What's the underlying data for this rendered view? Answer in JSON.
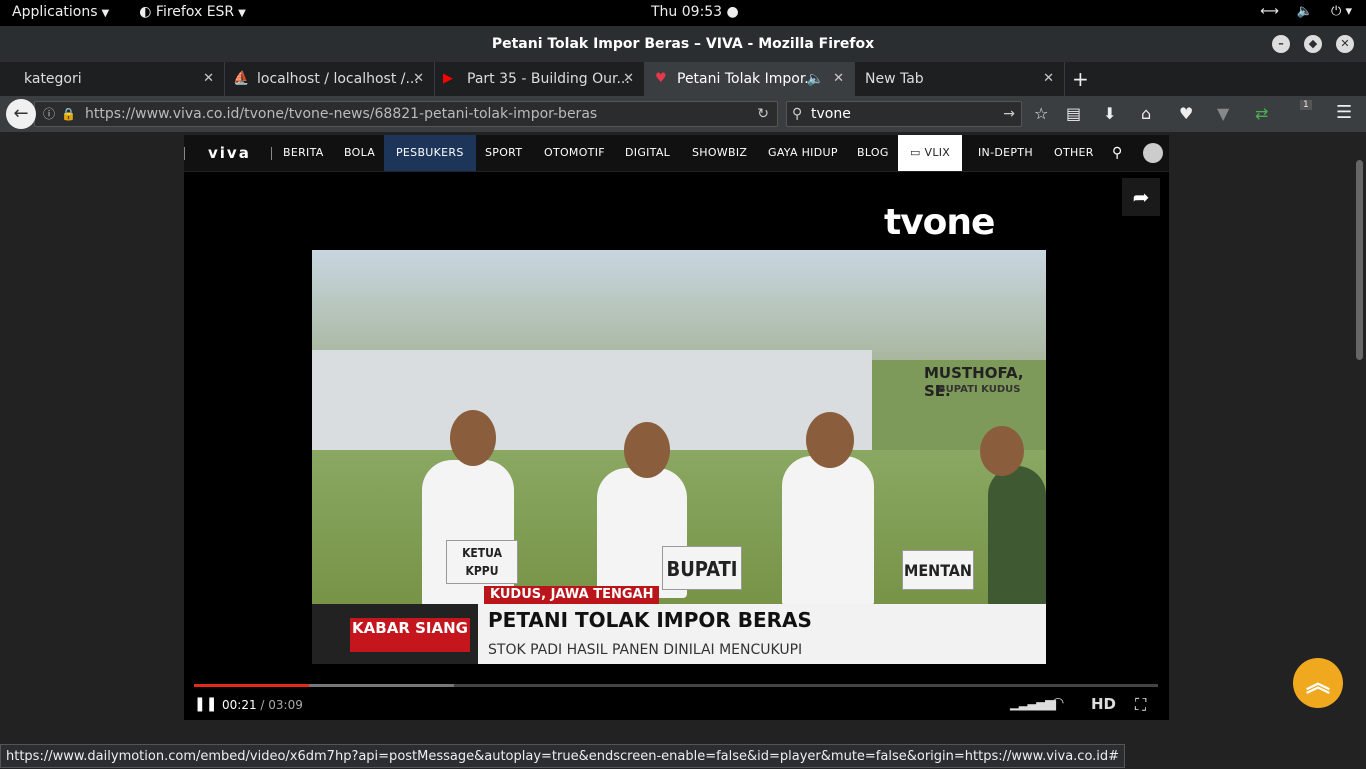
{
  "topbar": {
    "applications": "Applications",
    "app_name": "Firefox ESR",
    "clock": "Thu 09:53"
  },
  "window": {
    "title": "Petani Tolak Impor Beras – VIVA - Mozilla Firefox"
  },
  "tabs": [
    {
      "label": "kategori"
    },
    {
      "label": "localhost / localhost /..."
    },
    {
      "label": "Part 35 - Building Our..."
    },
    {
      "label": "Petani Tolak Impor..."
    },
    {
      "label": "New Tab"
    }
  ],
  "navbar": {
    "url": "https://www.viva.co.id/tvone/tvone-news/68821-petani-tolak-impor-beras",
    "search_value": "tvone",
    "badge_count": "1"
  },
  "site": {
    "logo": "viva",
    "nav": [
      "BERITA",
      "BOLA",
      "PESBUKERS",
      "SPORT",
      "OTOMOTIF",
      "DIGITAL",
      "SHOWBIZ",
      "GAYA HIDUP",
      "BLOG",
      "VLIX",
      "IN-DEPTH",
      "OTHER"
    ]
  },
  "video": {
    "channel_logo": "tvone",
    "location": "KUDUS, JAWA TENGAH",
    "program": "KABAR SIANG",
    "headline": "PETANI TOLAK IMPOR BERAS",
    "subheadline": "STOK PADI HASIL PANEN DINILAI MENCUKUPI",
    "caption_name": "MUSTHOFA, SE.",
    "caption_role": "BUPATI KUDUS",
    "signs": [
      "KETUA KPPU",
      "BUPATI",
      "MENTAN"
    ],
    "current_time": "00:21",
    "duration": "/ 03:09",
    "progress": 0.119,
    "buffered": 0.27,
    "quality": "HD"
  },
  "status_url": "https://www.dailymotion.com/embed/video/x6dm7hp?api=postMessage&autoplay=true&endscreen-enable=false&id=player&mute=false&origin=https://www.viva.co.id#",
  "colors": {
    "accent": "#e32a1b",
    "scroll_top": "#f0a81e",
    "nav_highlight": "#1c3559"
  }
}
